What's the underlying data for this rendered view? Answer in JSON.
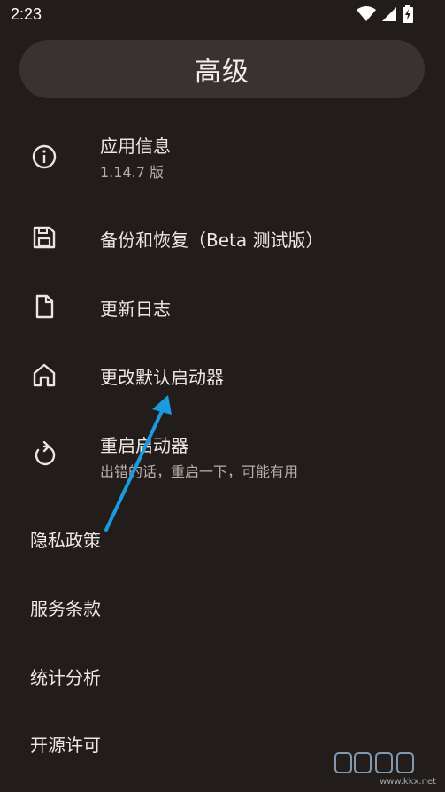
{
  "status": {
    "time": "2:23"
  },
  "header": {
    "title": "高级"
  },
  "items": [
    {
      "label": "应用信息",
      "sub": "1.14.7 版"
    },
    {
      "label": "备份和恢复（Beta 测试版）"
    },
    {
      "label": "更新日志"
    },
    {
      "label": "更改默认启动器"
    },
    {
      "label": "重启启动器",
      "sub": "出错的话，重启一下，可能有用"
    }
  ],
  "links": [
    {
      "label": "隐私政策"
    },
    {
      "label": "服务条款"
    },
    {
      "label": "统计分析"
    },
    {
      "label": "开源许可"
    }
  ],
  "watermark": {
    "url": "www.kkx.net"
  },
  "colors": {
    "background": "#221d1b",
    "titlebar": "#3a3230",
    "annotation_arrow": "#1a9be0"
  }
}
